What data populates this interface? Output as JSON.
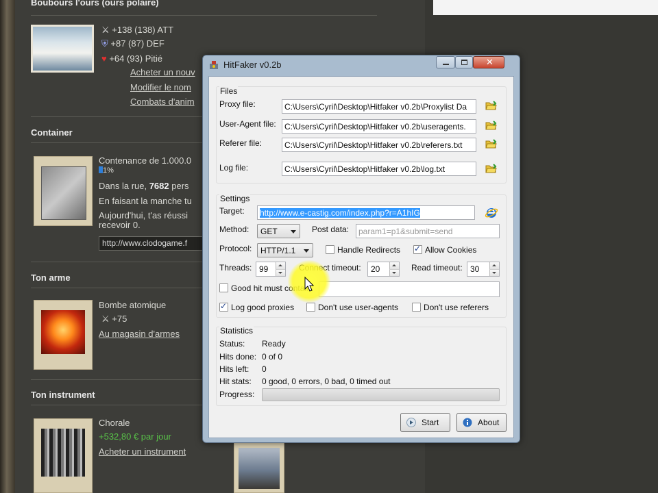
{
  "background": {
    "header_title": "Boubours l'ours (ours polaire)",
    "bear_stats": [
      {
        "icon": "swords-icon",
        "text": "+138 (138) ATT"
      },
      {
        "icon": "shield-icon",
        "text": "+87 (87) DEF"
      },
      {
        "icon": "heart-icon",
        "text": "+64 (93) Pitié"
      }
    ],
    "bear_links": [
      "Acheter un nouv",
      "Modifier le nom",
      "Combats d'anim"
    ],
    "container": {
      "title": "Container",
      "line1": "Contenance de 1.000.0",
      "percent": "1%",
      "line2_prefix": "Dans la rue, ",
      "line2_bold": "7682",
      "line2_suffix": " pers",
      "line3": "En faisant la manche tu",
      "line4": "Aujourd'hui, t'as réussi",
      "line5": "recevoir 0.",
      "url_input": "http://www.clodogame.f"
    },
    "weapon": {
      "title": "Ton arme",
      "name": "Bombe atomique",
      "stat": "+75",
      "link": "Au magasin d'armes"
    },
    "instrument": {
      "title": "Ton instrument",
      "name": "Chorale",
      "income": "+532,80 € par jour",
      "link": "Acheter un instrument"
    }
  },
  "window": {
    "title": "HitFaker v0.2b",
    "files": {
      "group_label": "Files",
      "rows": [
        {
          "label": "Proxy file:",
          "value": "C:\\Users\\Cyril\\Desktop\\Hitfaker v0.2b\\Proxylist Da"
        },
        {
          "label": "User-Agent file:",
          "value": "C:\\Users\\Cyril\\Desktop\\Hitfaker v0.2b\\useragents."
        },
        {
          "label": "Referer file:",
          "value": "C:\\Users\\Cyril\\Desktop\\Hitfaker v0.2b\\referers.txt"
        },
        {
          "label": "Log file:",
          "value": "C:\\Users\\Cyril\\Desktop\\Hitfaker v0.2b\\log.txt"
        }
      ]
    },
    "settings": {
      "group_label": "Settings",
      "target_label": "Target:",
      "target_value": "http://www.e-castig.com/index.php?r=A1hIG",
      "method_label": "Method:",
      "method_value": "GET",
      "post_label": "Post data:",
      "post_placeholder": "param1=p1&submit=send",
      "protocol_label": "Protocol:",
      "protocol_value": "HTTP/1.1",
      "handle_redirects": "Handle Redirects",
      "allow_cookies": "Allow Cookies",
      "threads_label": "Threads:",
      "threads_value": "99",
      "connect_timeout_label": "Connect timeout:",
      "connect_timeout_value": "20",
      "read_timeout_label": "Read timeout:",
      "read_timeout_value": "30",
      "good_hit_label": "Good hit must contain:",
      "log_good_proxies": "Log good proxies",
      "dont_use_useragents": "Don't use user-agents",
      "dont_use_referers": "Don't use referers"
    },
    "statistics": {
      "group_label": "Statistics",
      "status_label": "Status:",
      "status_value": "Ready",
      "hits_done_label": "Hits done:",
      "hits_done_value": "0 of 0",
      "hits_left_label": "Hits left:",
      "hits_left_value": "0",
      "hit_stats_label": "Hit stats:",
      "hit_stats_value": "0 good, 0 errors, 0 bad, 0 timed out",
      "progress_label": "Progress:",
      "progress_fraction": 0
    },
    "buttons": {
      "start": "Start",
      "about": "About"
    }
  }
}
